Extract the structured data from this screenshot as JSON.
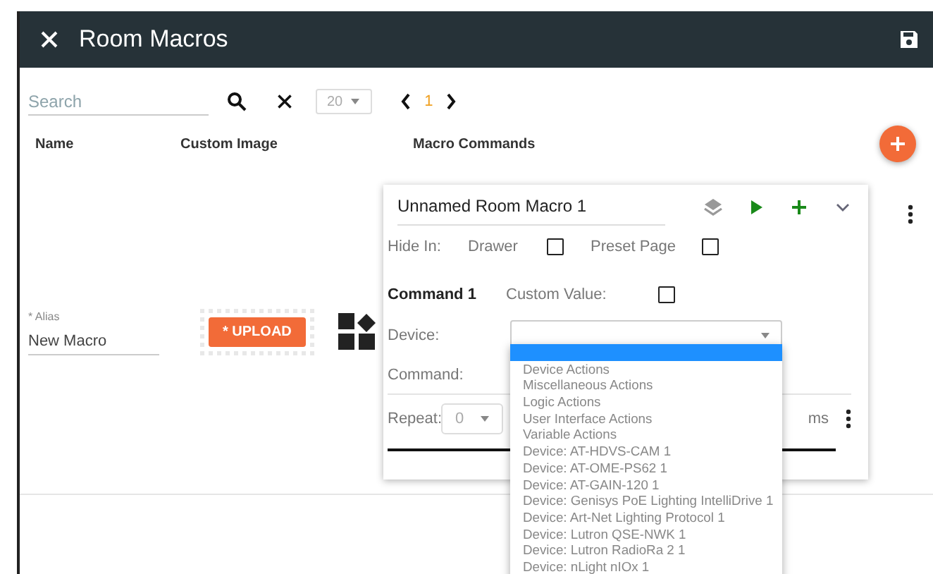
{
  "window": {
    "title": "Room Macros"
  },
  "toolbar": {
    "search": {
      "placeholder": "Search"
    },
    "page_size": "20",
    "pages": [
      {
        "label": "1",
        "selected": true
      }
    ]
  },
  "table": {
    "columns": [
      "Name",
      "Custom Image",
      "Macro Commands"
    ],
    "rows": [
      {
        "alias": {
          "label": "* Alias",
          "value": "New Macro"
        },
        "upload_button": "* UPLOAD",
        "macro": {
          "title": "Unnamed Room Macro 1",
          "hide_in": {
            "label": "Hide In:",
            "options": [
              {
                "label": "Drawer",
                "checked": false
              },
              {
                "label": "Preset Page",
                "checked": false
              }
            ]
          },
          "command": {
            "title": "Command 1",
            "custom_value": {
              "label": "Custom Value:",
              "checked": false
            },
            "device_label": "Device:",
            "command_label": "Command:",
            "repeat_label": "Repeat:",
            "repeat_value": "0",
            "unit": "ms",
            "device_dropdown": {
              "expanded": true,
              "options": [
                {
                  "selected": true
                },
                {
                  "label": "Device Actions",
                  "selected": false
                },
                {
                  "label": "Miscellaneous Actions",
                  "selected": false
                },
                {
                  "label": "Logic Actions",
                  "selected": false
                },
                {
                  "label": "User Interface Actions",
                  "selected": false
                },
                {
                  "label": "Variable Actions",
                  "selected": false
                },
                {
                  "label": "Device: AT-HDVS-CAM 1",
                  "selected": false
                },
                {
                  "label": "Device: AT-OME-PS62 1",
                  "selected": false
                },
                {
                  "label": "Device: AT-GAIN-120 1",
                  "selected": false
                },
                {
                  "label": "Device: Genisys PoE Lighting IntelliDrive 1",
                  "selected": false
                },
                {
                  "label": "Device: Art-Net Lighting Protocol 1",
                  "selected": false
                },
                {
                  "label": "Device: Lutron QSE-NWK 1",
                  "selected": false
                },
                {
                  "label": "Device: Lutron RadioRa 2 1",
                  "selected": false
                },
                {
                  "label": "Device: nLight nIOx 1",
                  "selected": false
                }
              ]
            }
          }
        }
      }
    ]
  }
}
